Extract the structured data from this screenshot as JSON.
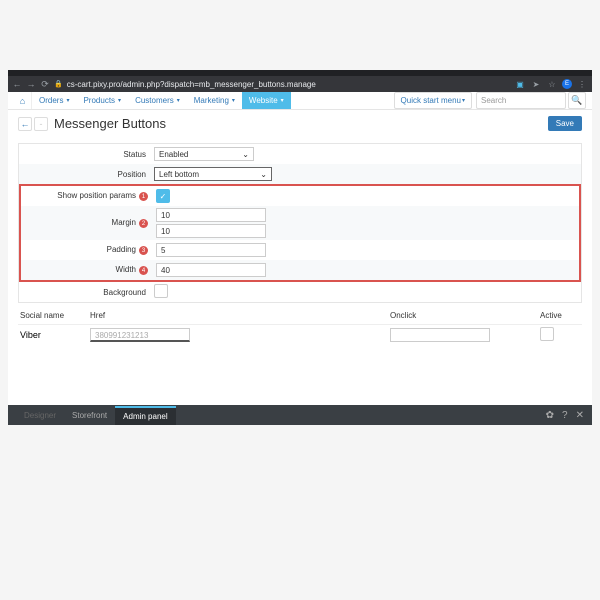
{
  "browser": {
    "url": "cs-cart.pixy.pro/admin.php?dispatch=mb_messenger_buttons.manage",
    "avatar_letter": "E"
  },
  "nav": {
    "orders": "Orders",
    "products": "Products",
    "customers": "Customers",
    "marketing": "Marketing",
    "website": "Website",
    "quickstart": "Quick start menu",
    "search_placeholder": "Search"
  },
  "title": "Messenger Buttons",
  "save": "Save",
  "form": {
    "status_label": "Status",
    "status_value": "Enabled",
    "position_label": "Position",
    "position_value": "Left bottom",
    "show_params_label": "Show position params",
    "margin_label": "Margin",
    "margin_top": "10",
    "margin_bottom": "10",
    "padding_label": "Padding",
    "padding_value": "5",
    "width_label": "Width",
    "width_value": "40",
    "background_label": "Background"
  },
  "badges": {
    "b1": "1",
    "b2": "2",
    "b3": "3",
    "b4": "4"
  },
  "social": {
    "hdr_name": "Social name",
    "hdr_href": "Href",
    "hdr_onclick": "Onclick",
    "hdr_active": "Active",
    "row1_name": "Viber",
    "row1_href": "380991231213"
  },
  "bottom": {
    "designer": "Designer",
    "storefront": "Storefront",
    "admin_panel": "Admin panel"
  }
}
